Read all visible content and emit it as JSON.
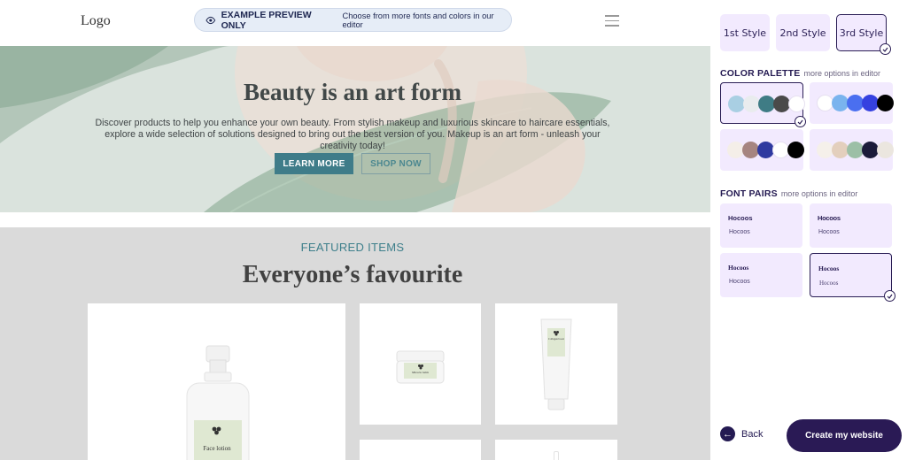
{
  "header": {
    "logo": "Logo",
    "preview_badge": "EXAMPLE PREVIEW ONLY",
    "preview_note": "Choose from more fonts and colors in our editor"
  },
  "hero": {
    "title": "Beauty is an art form",
    "text": "Discover products to help you enhance your own beauty. From stylish makeup and luxurious skincare to haircare essentials, explore a wide selection of solutions designed to bring out the best version of you. Makeup is an art form - unleash your creativity today!",
    "learn_more": "LEARN MORE",
    "shop_now": "SHOP NOW"
  },
  "featured": {
    "label": "FEATURED ITEMS",
    "title": "Everyone’s favourite",
    "products": [
      {
        "label": "Face lotion",
        "icon": "leaf-logo-icon"
      },
      {
        "label": "Miracle balm",
        "icon": "leaf-logo-icon"
      },
      {
        "label": "Collagen boost",
        "icon": "leaf-logo-icon"
      }
    ]
  },
  "sidebar": {
    "styles": [
      "1st Style",
      "2nd Style",
      "3rd Style"
    ],
    "selected_style": "3rd Style",
    "palette_title": "COLOR PALETTE",
    "palette_note": "more options in editor",
    "palettes": [
      [
        "#a9cfe3",
        "#e9ecee",
        "#3f7c85",
        "#4a4a4a",
        "#ffffff"
      ],
      [
        "#ffffff",
        "#7ab4ee",
        "#4a6ff0",
        "#3541e0",
        "#000000"
      ],
      [
        "#f4eee8",
        "#a68580",
        "#2f3aa0",
        "#ffffff",
        "#000000"
      ],
      [
        "#f5f0ea",
        "#e3cfbd",
        "#9cbfa6",
        "#1b1b3a",
        "#ebe6df"
      ]
    ],
    "selected_palette": 0,
    "fonts_title": "FONT PAIRS",
    "fonts_note": "more options in editor",
    "font_pairs": [
      {
        "heading": "Hocoos",
        "body": "Hocoos"
      },
      {
        "heading": "Hocoos",
        "body": "Hocoos"
      },
      {
        "heading": "Hocoos",
        "body": "Hocoos"
      },
      {
        "heading": "Hocoos",
        "body": "Hocoos"
      }
    ],
    "selected_font_pair": 3,
    "back": "Back",
    "create": "Create my website",
    "accent": "#2a1a55"
  }
}
